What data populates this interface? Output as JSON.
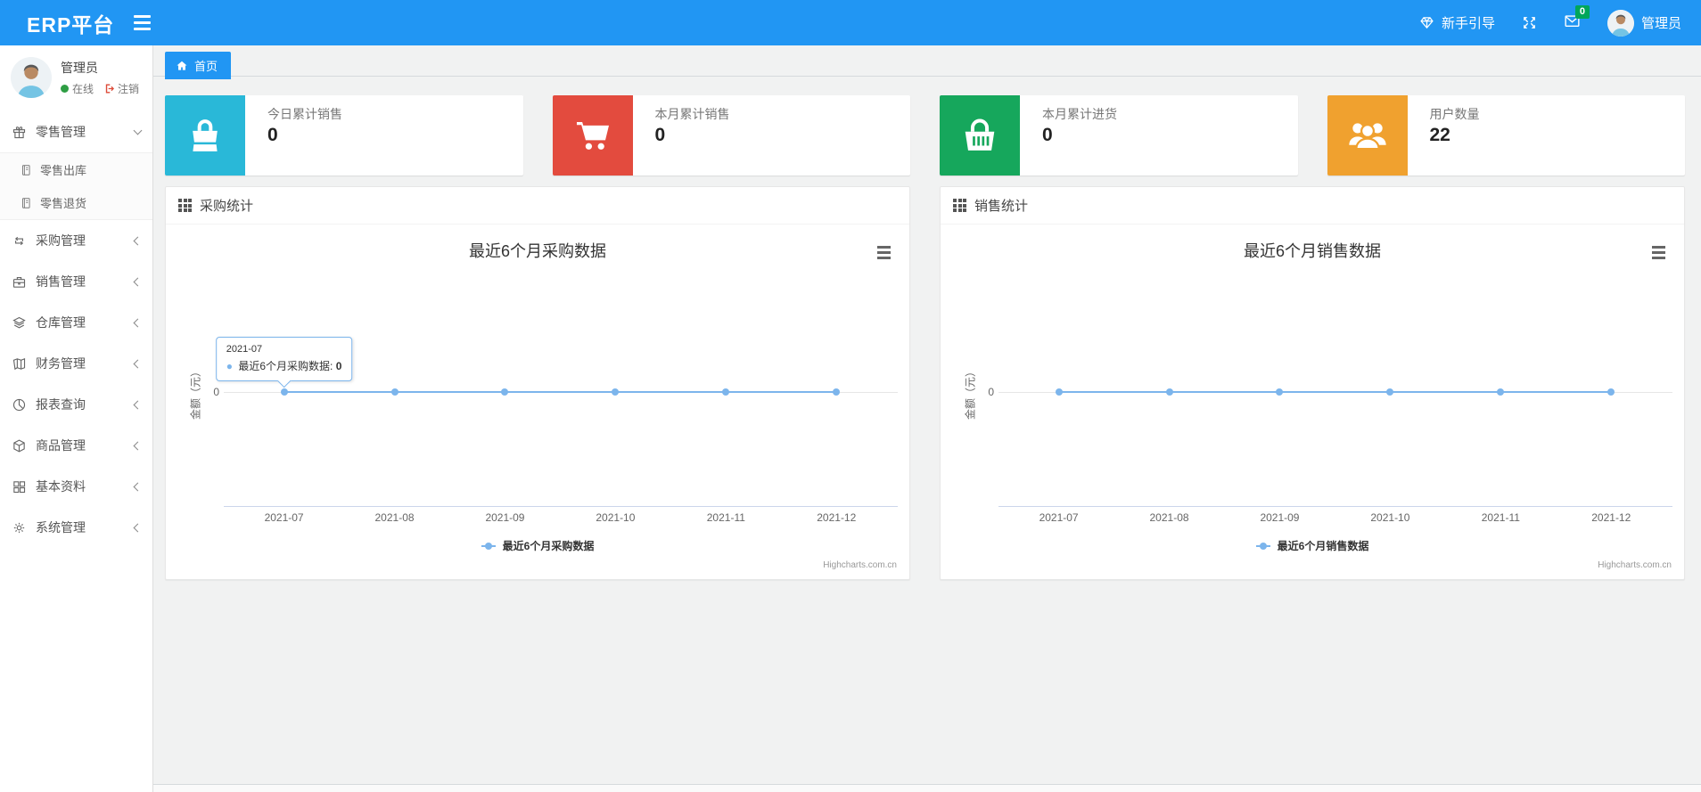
{
  "header": {
    "brand": "ERP平台",
    "guide_label": "新手引导",
    "guide_icon": "gem-icon",
    "fullscreen_icon": "fullscreen-icon",
    "messages_icon": "envelope-icon",
    "messages_badge": "0",
    "user_name": "管理员"
  },
  "sidebar": {
    "user": {
      "name": "管理员",
      "status": "在线",
      "logout": "注销"
    },
    "menu": [
      {
        "key": "retail-management",
        "label": "零售管理",
        "icon": "gift-icon",
        "expanded": true,
        "children": [
          {
            "key": "retail-outbound",
            "label": "零售出库",
            "icon": "journal-icon"
          },
          {
            "key": "retail-return",
            "label": "零售退货",
            "icon": "journal-icon"
          }
        ]
      },
      {
        "key": "purchase-management",
        "label": "采购管理",
        "icon": "repeat-icon"
      },
      {
        "key": "sales-management",
        "label": "销售管理",
        "icon": "briefcase-icon"
      },
      {
        "key": "warehouse-management",
        "label": "仓库管理",
        "icon": "layers-icon"
      },
      {
        "key": "finance-management",
        "label": "财务管理",
        "icon": "map-book-icon"
      },
      {
        "key": "report-query",
        "label": "报表查询",
        "icon": "pie-chart-icon"
      },
      {
        "key": "goods-management",
        "label": "商品管理",
        "icon": "cube-icon"
      },
      {
        "key": "basic-data",
        "label": "基本资料",
        "icon": "grid-icon"
      },
      {
        "key": "system-management",
        "label": "系统管理",
        "icon": "gear-icon"
      }
    ]
  },
  "breadcrumb": {
    "home_label": "首页",
    "home_icon": "home-icon"
  },
  "stats": [
    {
      "key": "today-sales",
      "label": "今日累计销售",
      "value": "0",
      "color": "#29b8d8",
      "icon": "shopping-bag-icon"
    },
    {
      "key": "month-sales",
      "label": "本月累计销售",
      "value": "0",
      "color": "#e34b3e",
      "icon": "cart-icon"
    },
    {
      "key": "month-purchase",
      "label": "本月累计进货",
      "value": "0",
      "color": "#16a75c",
      "icon": "basket-icon"
    },
    {
      "key": "user-count",
      "label": "用户数量",
      "value": "22",
      "color": "#f0a12f",
      "icon": "users-icon"
    }
  ],
  "chart_data": [
    {
      "type": "line",
      "panel_title": "采购统计",
      "title": "最近6个月采购数据",
      "categories": [
        "2021-07",
        "2021-08",
        "2021-09",
        "2021-10",
        "2021-11",
        "2021-12"
      ],
      "series": [
        {
          "name": "最近6个月采购数据",
          "values": [
            0,
            0,
            0,
            0,
            0,
            0
          ],
          "color": "#7cb5ec"
        }
      ],
      "ylabel": "金额（元）",
      "yticks": [
        "0"
      ],
      "ylim": [
        0,
        1
      ],
      "grid": true,
      "legend_position": "bottom-center",
      "credits": "Highcharts.com.cn",
      "tooltip": {
        "header": "2021-07",
        "label": "最近6个月采购数据",
        "value": "0",
        "point_index": 0
      }
    },
    {
      "type": "line",
      "panel_title": "销售统计",
      "title": "最近6个月销售数据",
      "categories": [
        "2021-07",
        "2021-08",
        "2021-09",
        "2021-10",
        "2021-11",
        "2021-12"
      ],
      "series": [
        {
          "name": "最近6个月销售数据",
          "values": [
            0,
            0,
            0,
            0,
            0,
            0
          ],
          "color": "#7cb5ec"
        }
      ],
      "ylabel": "金额（元）",
      "yticks": [
        "0"
      ],
      "ylim": [
        0,
        1
      ],
      "grid": true,
      "legend_position": "bottom-center",
      "credits": "Highcharts.com.cn",
      "tooltip": null
    }
  ]
}
